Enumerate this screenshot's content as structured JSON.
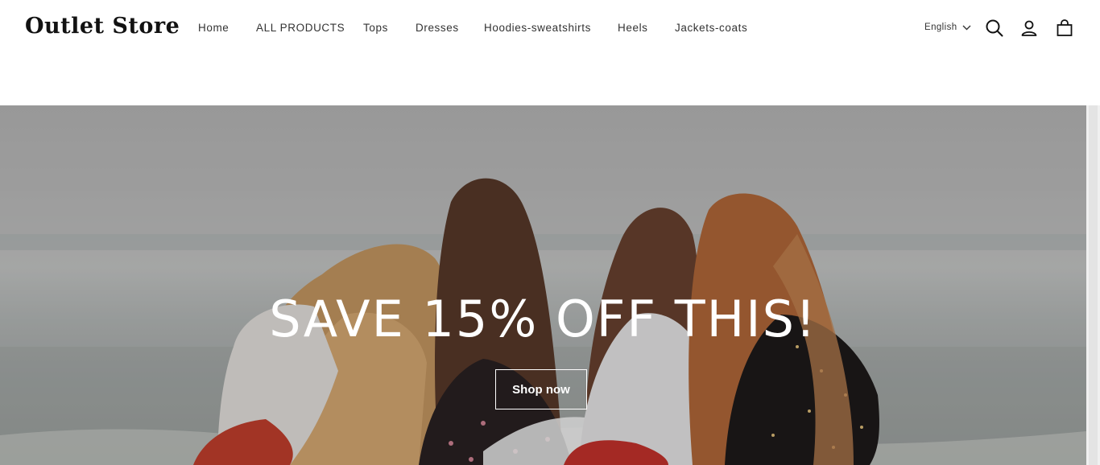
{
  "brand": {
    "name": "Outlet Store"
  },
  "nav": {
    "items": [
      {
        "label": "Home"
      },
      {
        "label": "ALL PRODUCTS"
      },
      {
        "label": "Tops"
      },
      {
        "label": "Dresses"
      },
      {
        "label": "Hoodies-sweatshirts"
      },
      {
        "label": "Heels"
      },
      {
        "label": "Jackets-coats"
      }
    ]
  },
  "header_actions": {
    "language": "English",
    "icons": [
      "search-icon",
      "account-icon",
      "cart-icon"
    ]
  },
  "hero": {
    "title": "SAVE 15% OFF THIS!",
    "button_label": "Shop now"
  }
}
